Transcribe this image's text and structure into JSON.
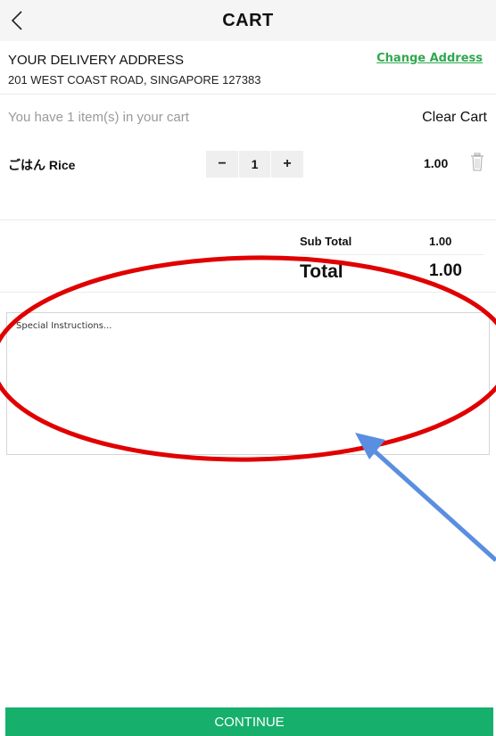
{
  "header": {
    "title": "CART",
    "back_icon": "chevron-left-icon"
  },
  "address": {
    "label": "YOUR DELIVERY ADDRESS",
    "value": "201 WEST COAST ROAD, SINGAPORE 127383",
    "change_label": "Change Address"
  },
  "cart": {
    "summary": "You have 1 item(s) in your cart",
    "clear_label": "Clear Cart",
    "items": [
      {
        "name": "ごはん Rice",
        "quantity": "1",
        "decrement": "−",
        "increment": "+",
        "price": "1.00",
        "delete_icon": "trash-icon"
      }
    ]
  },
  "totals": {
    "subtotal_label": "Sub Total",
    "subtotal_value": "1.00",
    "total_label": "Total",
    "total_value": "1.00"
  },
  "instructions": {
    "placeholder": "Special Instructions...",
    "value": ""
  },
  "footer": {
    "continue_label": "CONTINUE"
  },
  "colors": {
    "brand_green": "#16b06c",
    "link_green": "#2fa84f",
    "annotation_red": "#e00000",
    "annotation_blue": "#5a8ee0"
  }
}
